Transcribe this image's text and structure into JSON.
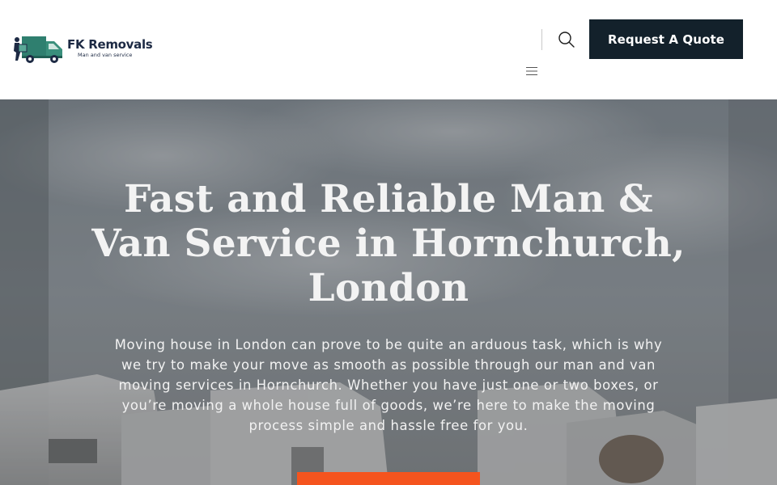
{
  "header": {
    "logo": {
      "title": "FK Removals",
      "subtitle": "Man and van service",
      "icon": "van-with-mover-logo",
      "colors": {
        "van": "#2e7d6e",
        "text": "#1d2a44"
      }
    },
    "search_icon": "search-icon",
    "menu_icon": "hamburger-menu-icon",
    "quote_button_label": "Request A Quote",
    "quote_button_color": "#13212b"
  },
  "hero": {
    "title": "Fast and Reliable Man & Van Service in Hornchurch, London",
    "description": "Moving house in London can prove to be quite an arduous task, which is why we try to make your move as smooth as possible through our man and van moving services in Hornchurch. Whether you have just one or two boxes, or you’re moving a whole house full of goods, we’re here to make the moving process simple and hassle free for you.",
    "background": "white-vans-parked-under-cloudy-sky",
    "cta_color": "#f5541e"
  }
}
